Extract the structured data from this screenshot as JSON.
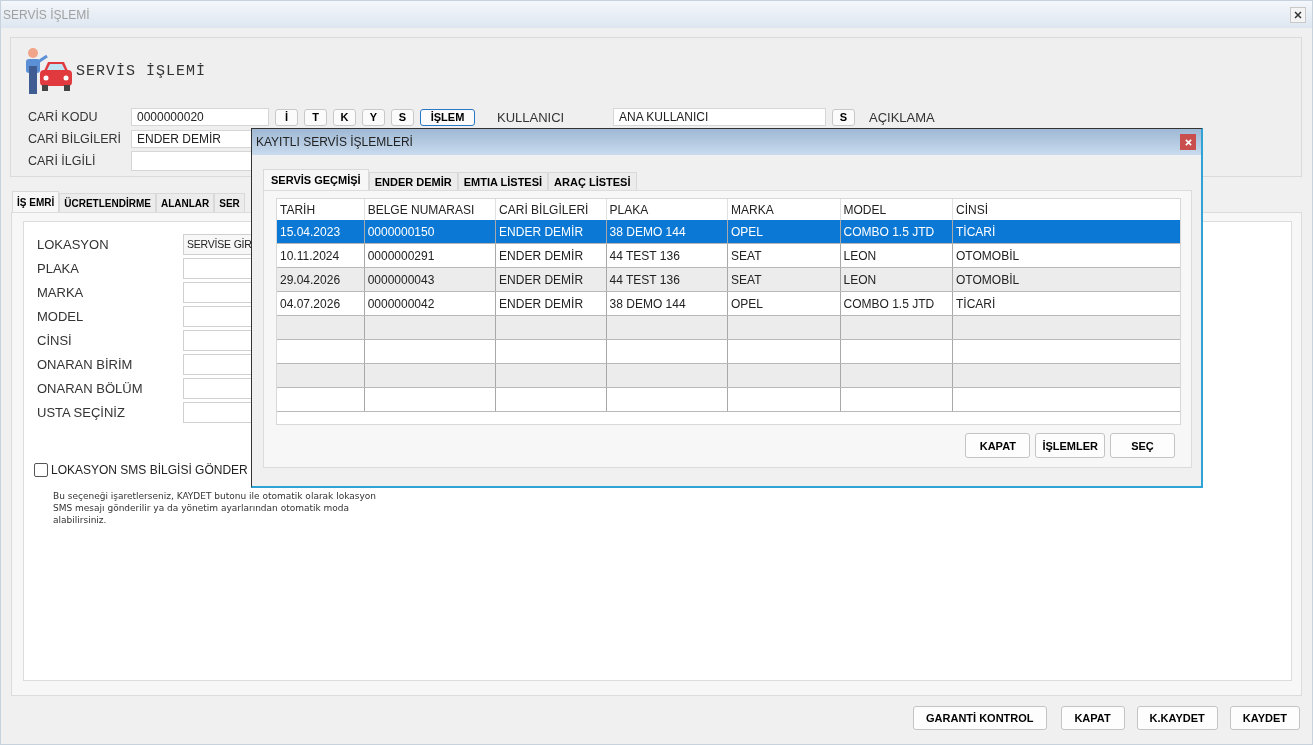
{
  "window": {
    "title": "SERVİS İŞLEMİ"
  },
  "header": {
    "title": "SERVİS İŞLEMİ",
    "fields": [
      {
        "label": "CARİ KODU",
        "value": "0000000020"
      },
      {
        "label": "CARİ BİLGİLERİ",
        "value": "ENDER DEMİR"
      },
      {
        "label": "CARİ İLGİLİ"
      }
    ],
    "quick_buttons": [
      {
        "label": "İ",
        "selected": false
      },
      {
        "label": "T",
        "selected": false
      },
      {
        "label": "K",
        "selected": false
      },
      {
        "label": "Y",
        "selected": false
      },
      {
        "label": "S",
        "selected": false
      },
      {
        "label": "İŞLEM",
        "selected": true
      }
    ],
    "user": {
      "label": "KULLANICI",
      "value": "ANA KULLANICI",
      "button": "S"
    },
    "description_label": "AÇIKLAMA"
  },
  "tabs": [
    {
      "label": "İŞ EMRİ",
      "selected": true
    },
    {
      "label": "ÜCRETLENDİRME",
      "selected": false
    },
    {
      "label": "ALANLAR",
      "selected": false
    },
    {
      "label": "SER",
      "selected": false
    }
  ],
  "form": {
    "fields": [
      {
        "label": "LOKASYON",
        "value": "SERVİSE GİR"
      },
      {
        "label": "PLAKA"
      },
      {
        "label": "MARKA"
      },
      {
        "label": "MODEL"
      },
      {
        "label": "CİNSİ"
      },
      {
        "label": "ONARAN BİRİM"
      },
      {
        "label": "ONARAN BÖLÜM"
      },
      {
        "label": "USTA SEÇİNİZ"
      }
    ],
    "sms": {
      "label": "LOKASYON SMS BİLGİSİ GÖNDER",
      "checked": false
    },
    "note": "Bu seçeneği işaretlerseniz, KAYDET butonu ile otomatik olarak lokasyon SMS mesajı gönderilir ya da yönetim ayarlarından otomatik moda alabilirsiniz."
  },
  "footer_buttons": [
    "GARANTİ KONTROL",
    "KAPAT",
    "K.KAYDET",
    "KAYDET"
  ],
  "dialog": {
    "title": "KAYITLI SERVİS İŞLEMLERİ",
    "tabs": [
      {
        "label": "SERVİS GEÇMİŞİ",
        "selected": true
      },
      {
        "label": "ENDER DEMİR",
        "selected": false
      },
      {
        "label": "EMTIA LİSTESİ",
        "selected": false
      },
      {
        "label": "ARAÇ LİSTESİ",
        "selected": false
      }
    ],
    "table": {
      "columns": [
        "TARİH",
        "BELGE NUMARASI",
        "CARİ BİLGİLERİ",
        "PLAKA",
        "MARKA",
        "MODEL",
        "CİNSİ"
      ],
      "rows": [
        {
          "cells": [
            "15.04.2023",
            "0000000150",
            "ENDER DEMİR",
            "38 DEMO 144",
            "OPEL",
            "COMBO 1.5 JTD",
            "TİCARİ"
          ],
          "selected": true
        },
        {
          "cells": [
            "10.11.2024",
            "0000000291",
            "ENDER DEMİR",
            "44 TEST 136",
            "SEAT",
            "LEON",
            "OTOMOBİL"
          ],
          "selected": false
        },
        {
          "cells": [
            "29.04.2026",
            "0000000043",
            "ENDER DEMİR",
            "44 TEST 136",
            "SEAT",
            "LEON",
            "OTOMOBİL"
          ],
          "selected": false
        },
        {
          "cells": [
            "04.07.2026",
            "0000000042",
            "ENDER DEMİR",
            "38 DEMO 144",
            "OPEL",
            "COMBO 1.5 JTD",
            "TİCARİ"
          ],
          "selected": false
        }
      ]
    },
    "buttons": [
      "KAPAT",
      "İŞLEMLER",
      "SEÇ"
    ]
  }
}
